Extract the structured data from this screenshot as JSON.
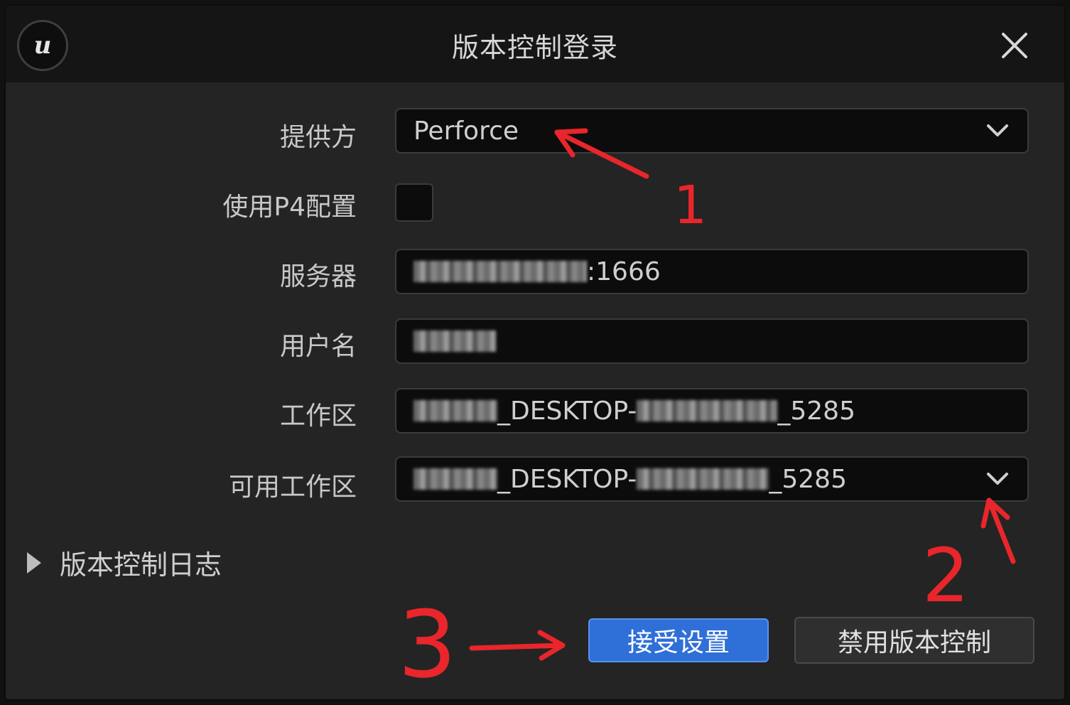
{
  "window": {
    "title": "版本控制登录",
    "logo_icon": "unreal-engine-logo",
    "close_icon": "close-icon"
  },
  "form": {
    "provider": {
      "label": "提供方",
      "value": "Perforce"
    },
    "use_p4_config": {
      "label": "使用P4配置",
      "checked": false
    },
    "server": {
      "label": "服务器",
      "suffix": ":1666"
    },
    "username": {
      "label": "用户名"
    },
    "workspace": {
      "label": "工作区",
      "part1": "_DESKTOP-",
      "part2": "_5285"
    },
    "available_workspaces": {
      "label": "可用工作区",
      "part1": "_DESKTOP-",
      "part2": "_5285"
    }
  },
  "log": {
    "label": "版本控制日志"
  },
  "buttons": {
    "accept": "接受设置",
    "disable": "禁用版本控制"
  },
  "annotations": {
    "n1": "1",
    "n2": "2",
    "n3": "3",
    "color": "#e8262b"
  },
  "colors": {
    "accent": "#2f6fd8",
    "background": "#242424",
    "titlebar": "#151515",
    "field": "#0c0c0c"
  }
}
